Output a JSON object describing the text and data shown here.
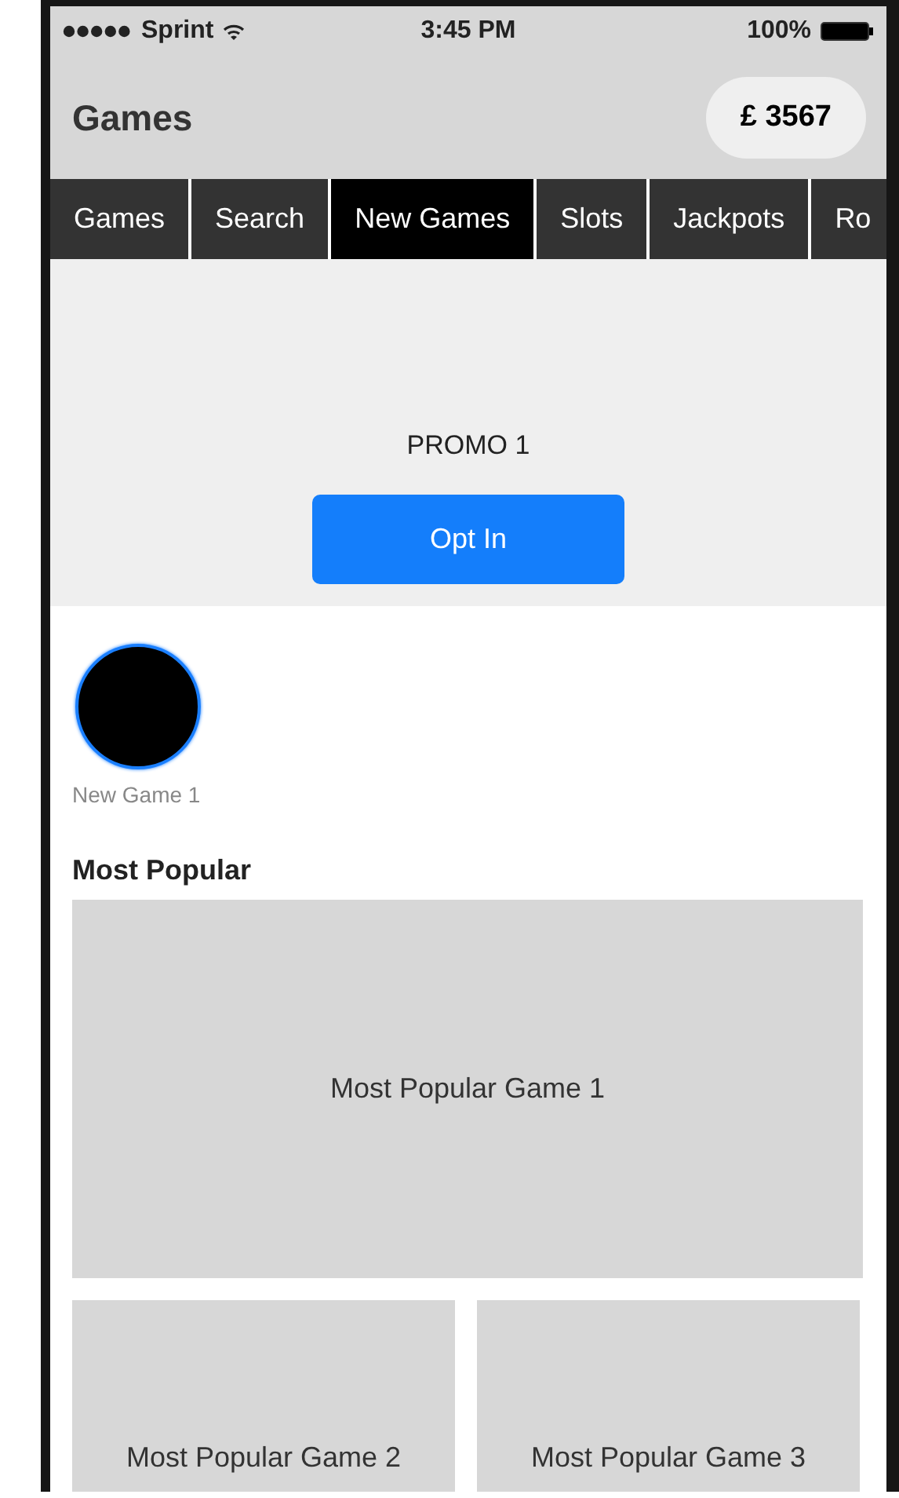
{
  "status_bar": {
    "carrier": "Sprint",
    "time": "3:45 PM",
    "battery": "100%"
  },
  "header": {
    "title": "Games",
    "balance": "£ 3567"
  },
  "tabs": [
    {
      "label": "Games",
      "selected": false
    },
    {
      "label": "Search",
      "selected": false
    },
    {
      "label": "New Games",
      "selected": true
    },
    {
      "label": "Slots",
      "selected": false
    },
    {
      "label": "Jackpots",
      "selected": false
    },
    {
      "label": "Ro",
      "selected": false
    }
  ],
  "promo": {
    "title": "PROMO 1",
    "button": "Opt In"
  },
  "new_games": [
    {
      "name": "New Game 1"
    }
  ],
  "most_popular": {
    "heading": "Most Popular",
    "games": [
      {
        "name": "Most Popular Game 1"
      },
      {
        "name": "Most Popular Game 2"
      },
      {
        "name": "Most Popular Game 3"
      }
    ]
  }
}
